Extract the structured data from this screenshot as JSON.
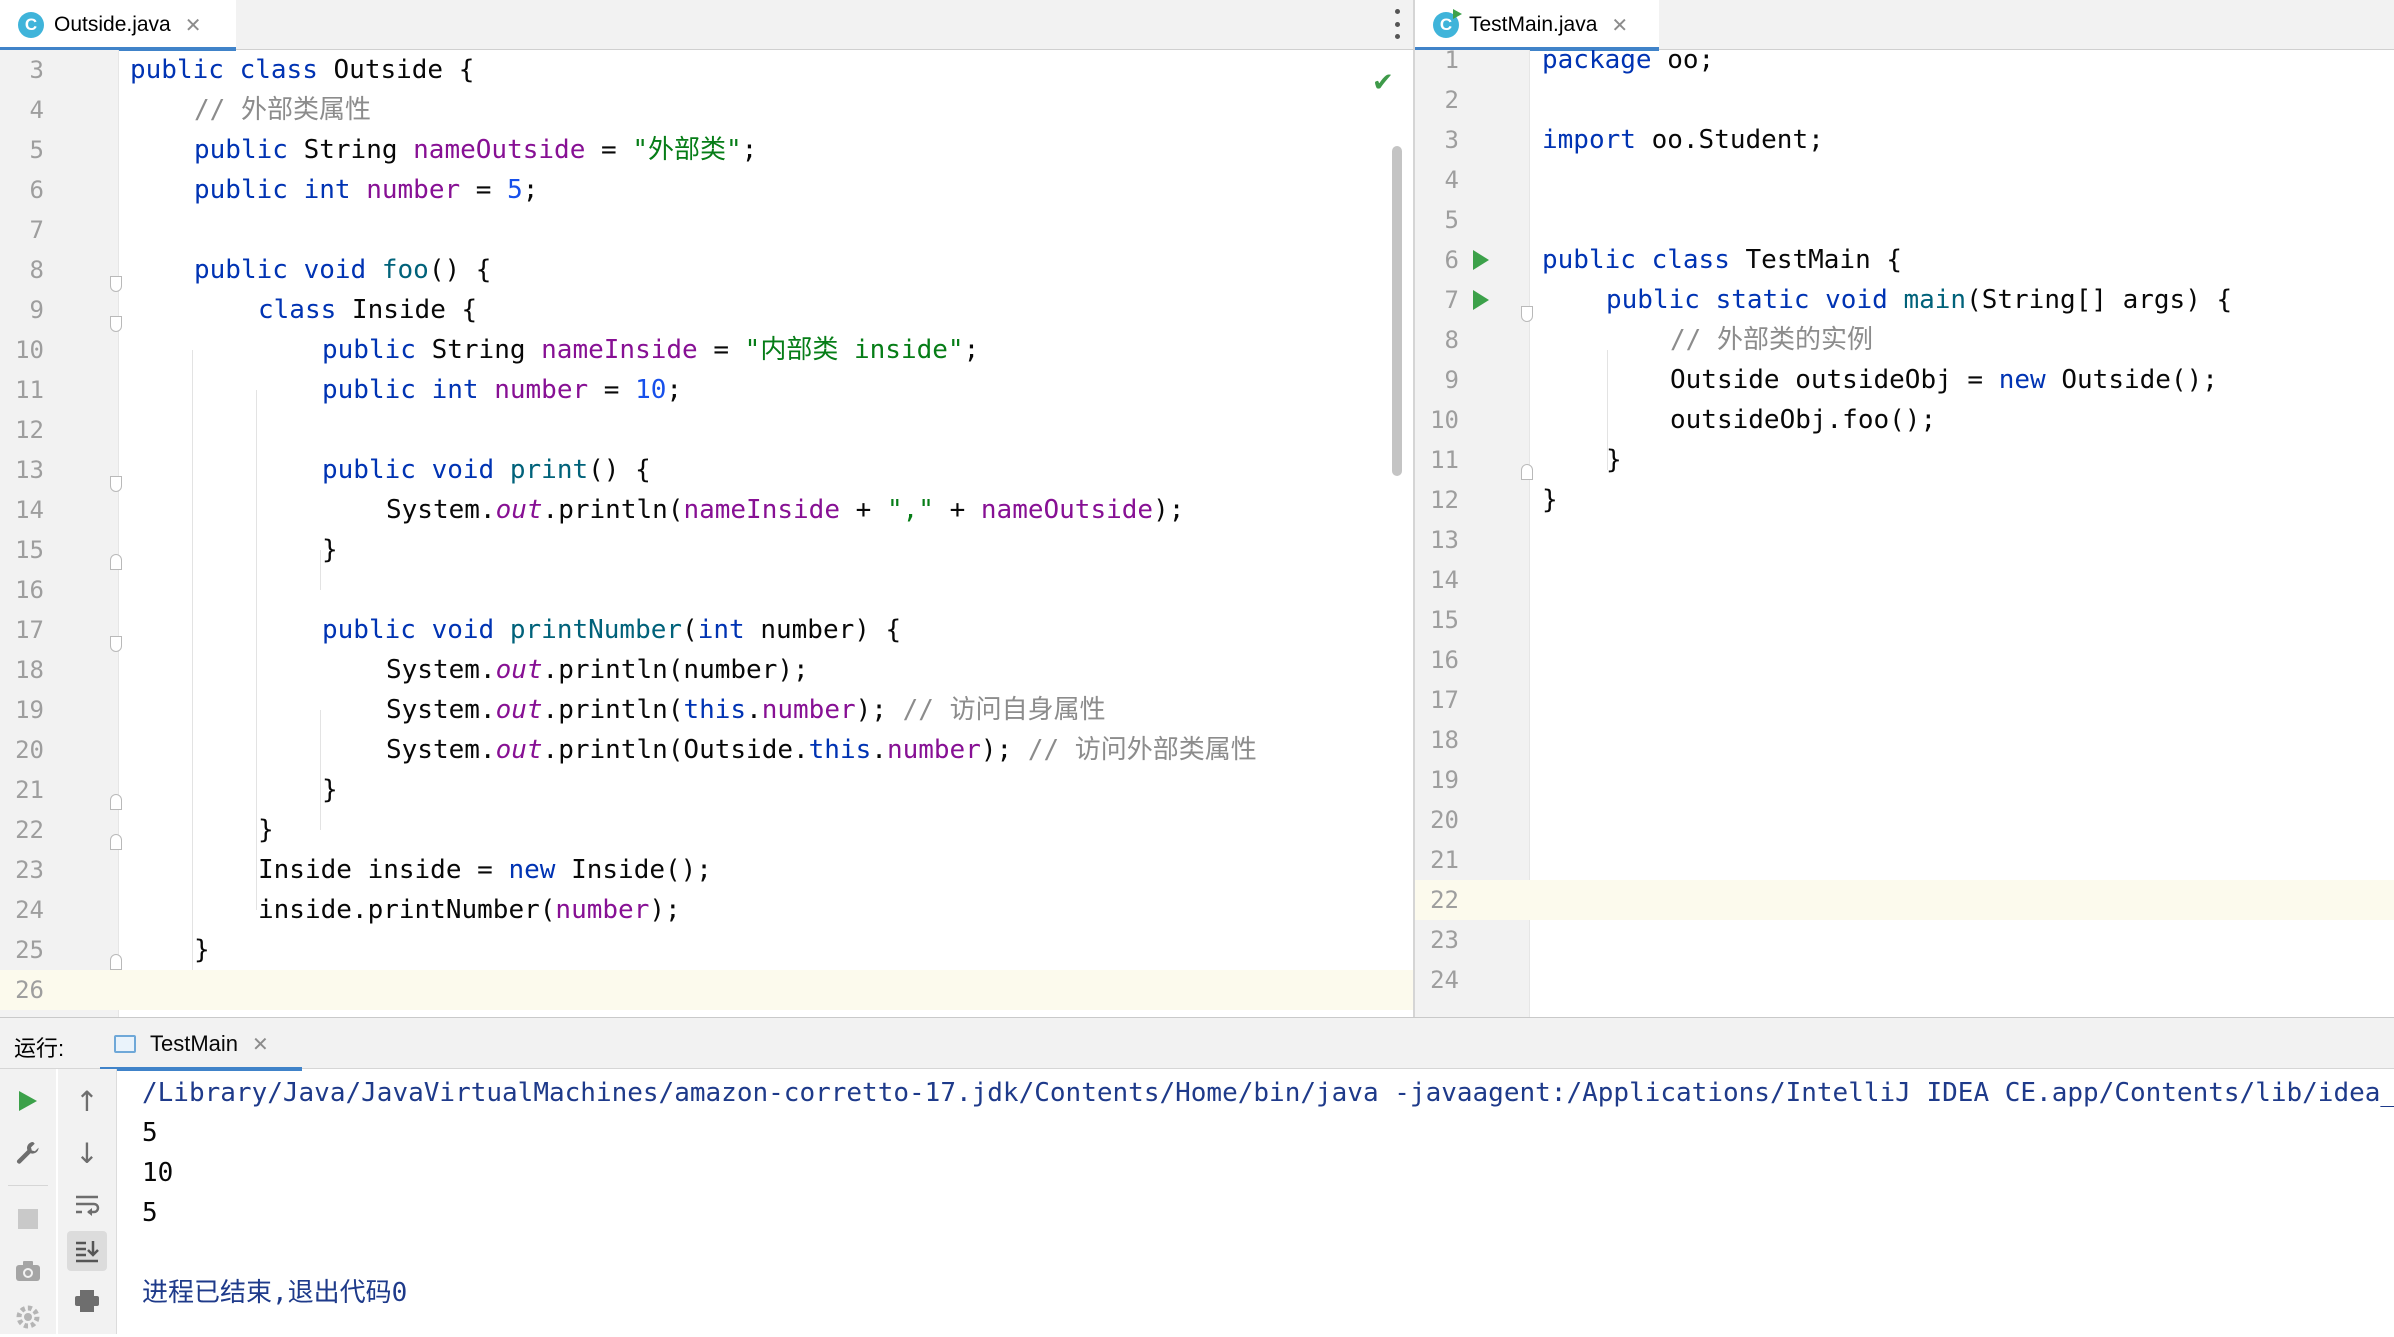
{
  "left_tab": {
    "icon": "C",
    "label": "Outside.java"
  },
  "right_tab": {
    "icon": "C",
    "label": "TestMain.java"
  },
  "outside_lines": [
    {
      "n": "3"
    },
    {
      "n": "4"
    },
    {
      "n": "5"
    },
    {
      "n": "6"
    },
    {
      "n": "7"
    },
    {
      "n": "8"
    },
    {
      "n": "9"
    },
    {
      "n": "10"
    },
    {
      "n": "11"
    },
    {
      "n": "12"
    },
    {
      "n": "13"
    },
    {
      "n": "14"
    },
    {
      "n": "15"
    },
    {
      "n": "16"
    },
    {
      "n": "17"
    },
    {
      "n": "18"
    },
    {
      "n": "19"
    },
    {
      "n": "20"
    },
    {
      "n": "21"
    },
    {
      "n": "22"
    },
    {
      "n": "23"
    },
    {
      "n": "24"
    },
    {
      "n": "25"
    },
    {
      "n": "26"
    }
  ],
  "outside_code": {
    "l3": [
      "public",
      " ",
      "class",
      " Outside {"
    ],
    "l4": "// 外部类属性",
    "l5": [
      "public",
      " String ",
      "nameOutside",
      " = ",
      "\"外部类\"",
      ";"
    ],
    "l6": [
      "public",
      " ",
      "int",
      " ",
      "number",
      " = ",
      "5",
      ";"
    ],
    "l8": [
      "public",
      " ",
      "void",
      " ",
      "foo",
      "() {"
    ],
    "l9": [
      "class",
      " Inside {"
    ],
    "l10": [
      "public",
      " String ",
      "nameInside",
      " = ",
      "\"内部类 inside\"",
      ";"
    ],
    "l11": [
      "public",
      " ",
      "int",
      " ",
      "number",
      " = ",
      "10",
      ";"
    ],
    "l13": [
      "public",
      " ",
      "void",
      " ",
      "print",
      "() {"
    ],
    "l14": [
      "System.",
      "out",
      ".println(",
      "nameInside",
      " + ",
      "\",\"",
      " + ",
      "nameOutside",
      ");"
    ],
    "l15": "}",
    "l17": [
      "public",
      " ",
      "void",
      " ",
      "printNumber",
      "(",
      "int",
      " number) {"
    ],
    "l18": [
      "System.",
      "out",
      ".println(number);"
    ],
    "l19": [
      "System.",
      "out",
      ".println(",
      "this",
      ".",
      "number",
      "); ",
      "// 访问自身属性"
    ],
    "l20": [
      "System.",
      "out",
      ".println(Outside.",
      "this",
      ".",
      "number",
      "); ",
      "// 访问外部类属性"
    ],
    "l21": "}",
    "l22": "}",
    "l23": [
      "Inside inside = ",
      "new",
      " Inside();"
    ],
    "l24": [
      "inside.printNumber(",
      "number",
      ");"
    ],
    "l25": "}"
  },
  "testmain_lines": [
    {
      "n": "1"
    },
    {
      "n": "2"
    },
    {
      "n": "3"
    },
    {
      "n": "4"
    },
    {
      "n": "5"
    },
    {
      "n": "6"
    },
    {
      "n": "7"
    },
    {
      "n": "8"
    },
    {
      "n": "9"
    },
    {
      "n": "10"
    },
    {
      "n": "11"
    },
    {
      "n": "12"
    },
    {
      "n": "13"
    },
    {
      "n": "14"
    },
    {
      "n": "15"
    },
    {
      "n": "16"
    },
    {
      "n": "17"
    },
    {
      "n": "18"
    },
    {
      "n": "19"
    },
    {
      "n": "20"
    },
    {
      "n": "21"
    },
    {
      "n": "22"
    },
    {
      "n": "23"
    },
    {
      "n": "24"
    }
  ],
  "testmain_code": {
    "l1": [
      "package",
      " oo;"
    ],
    "l3": [
      "import",
      " oo.Student;"
    ],
    "l6": [
      "public",
      " ",
      "class",
      " TestMain {"
    ],
    "l7": [
      "public",
      " ",
      "static",
      " ",
      "void",
      " ",
      "main",
      "(String[] args) {"
    ],
    "l8": "// 外部类的实例",
    "l9": [
      "Outside outsideObj = ",
      "new",
      " Outside();"
    ],
    "l10": "outsideObj.foo();",
    "l11": "}",
    "l12": "}"
  },
  "run_panel": {
    "label": "运行:",
    "tab_label": "TestMain",
    "console": {
      "command": "/Library/Java/JavaVirtualMachines/amazon-corretto-17.jdk/Contents/Home/bin/java -javaagent:/Applications/IntelliJ IDEA CE.app/Contents/lib/idea_rt.jar",
      "output": [
        "5",
        "10",
        "5"
      ],
      "exit_message": "进程已结束,退出代码0"
    }
  },
  "icons": {
    "tab_close": "close-icon",
    "run": "run-icon",
    "wrench": "wrench-icon",
    "stop": "stop-icon",
    "camera": "camera-icon",
    "settings": "settings-icon",
    "up": "arrow-up-icon",
    "down": "arrow-down-icon",
    "soft_wrap": "soft-wrap-icon",
    "scroll_end": "scroll-to-end-icon",
    "print": "print-icon",
    "inspection_ok": "inspection-ok-icon"
  },
  "colors": {
    "keyword": "#0033b3",
    "field": "#871094",
    "string": "#067d17",
    "number": "#1750eb",
    "comment": "#8c8c8c",
    "accent": "#4083c9",
    "run_green": "#3ca14a"
  }
}
